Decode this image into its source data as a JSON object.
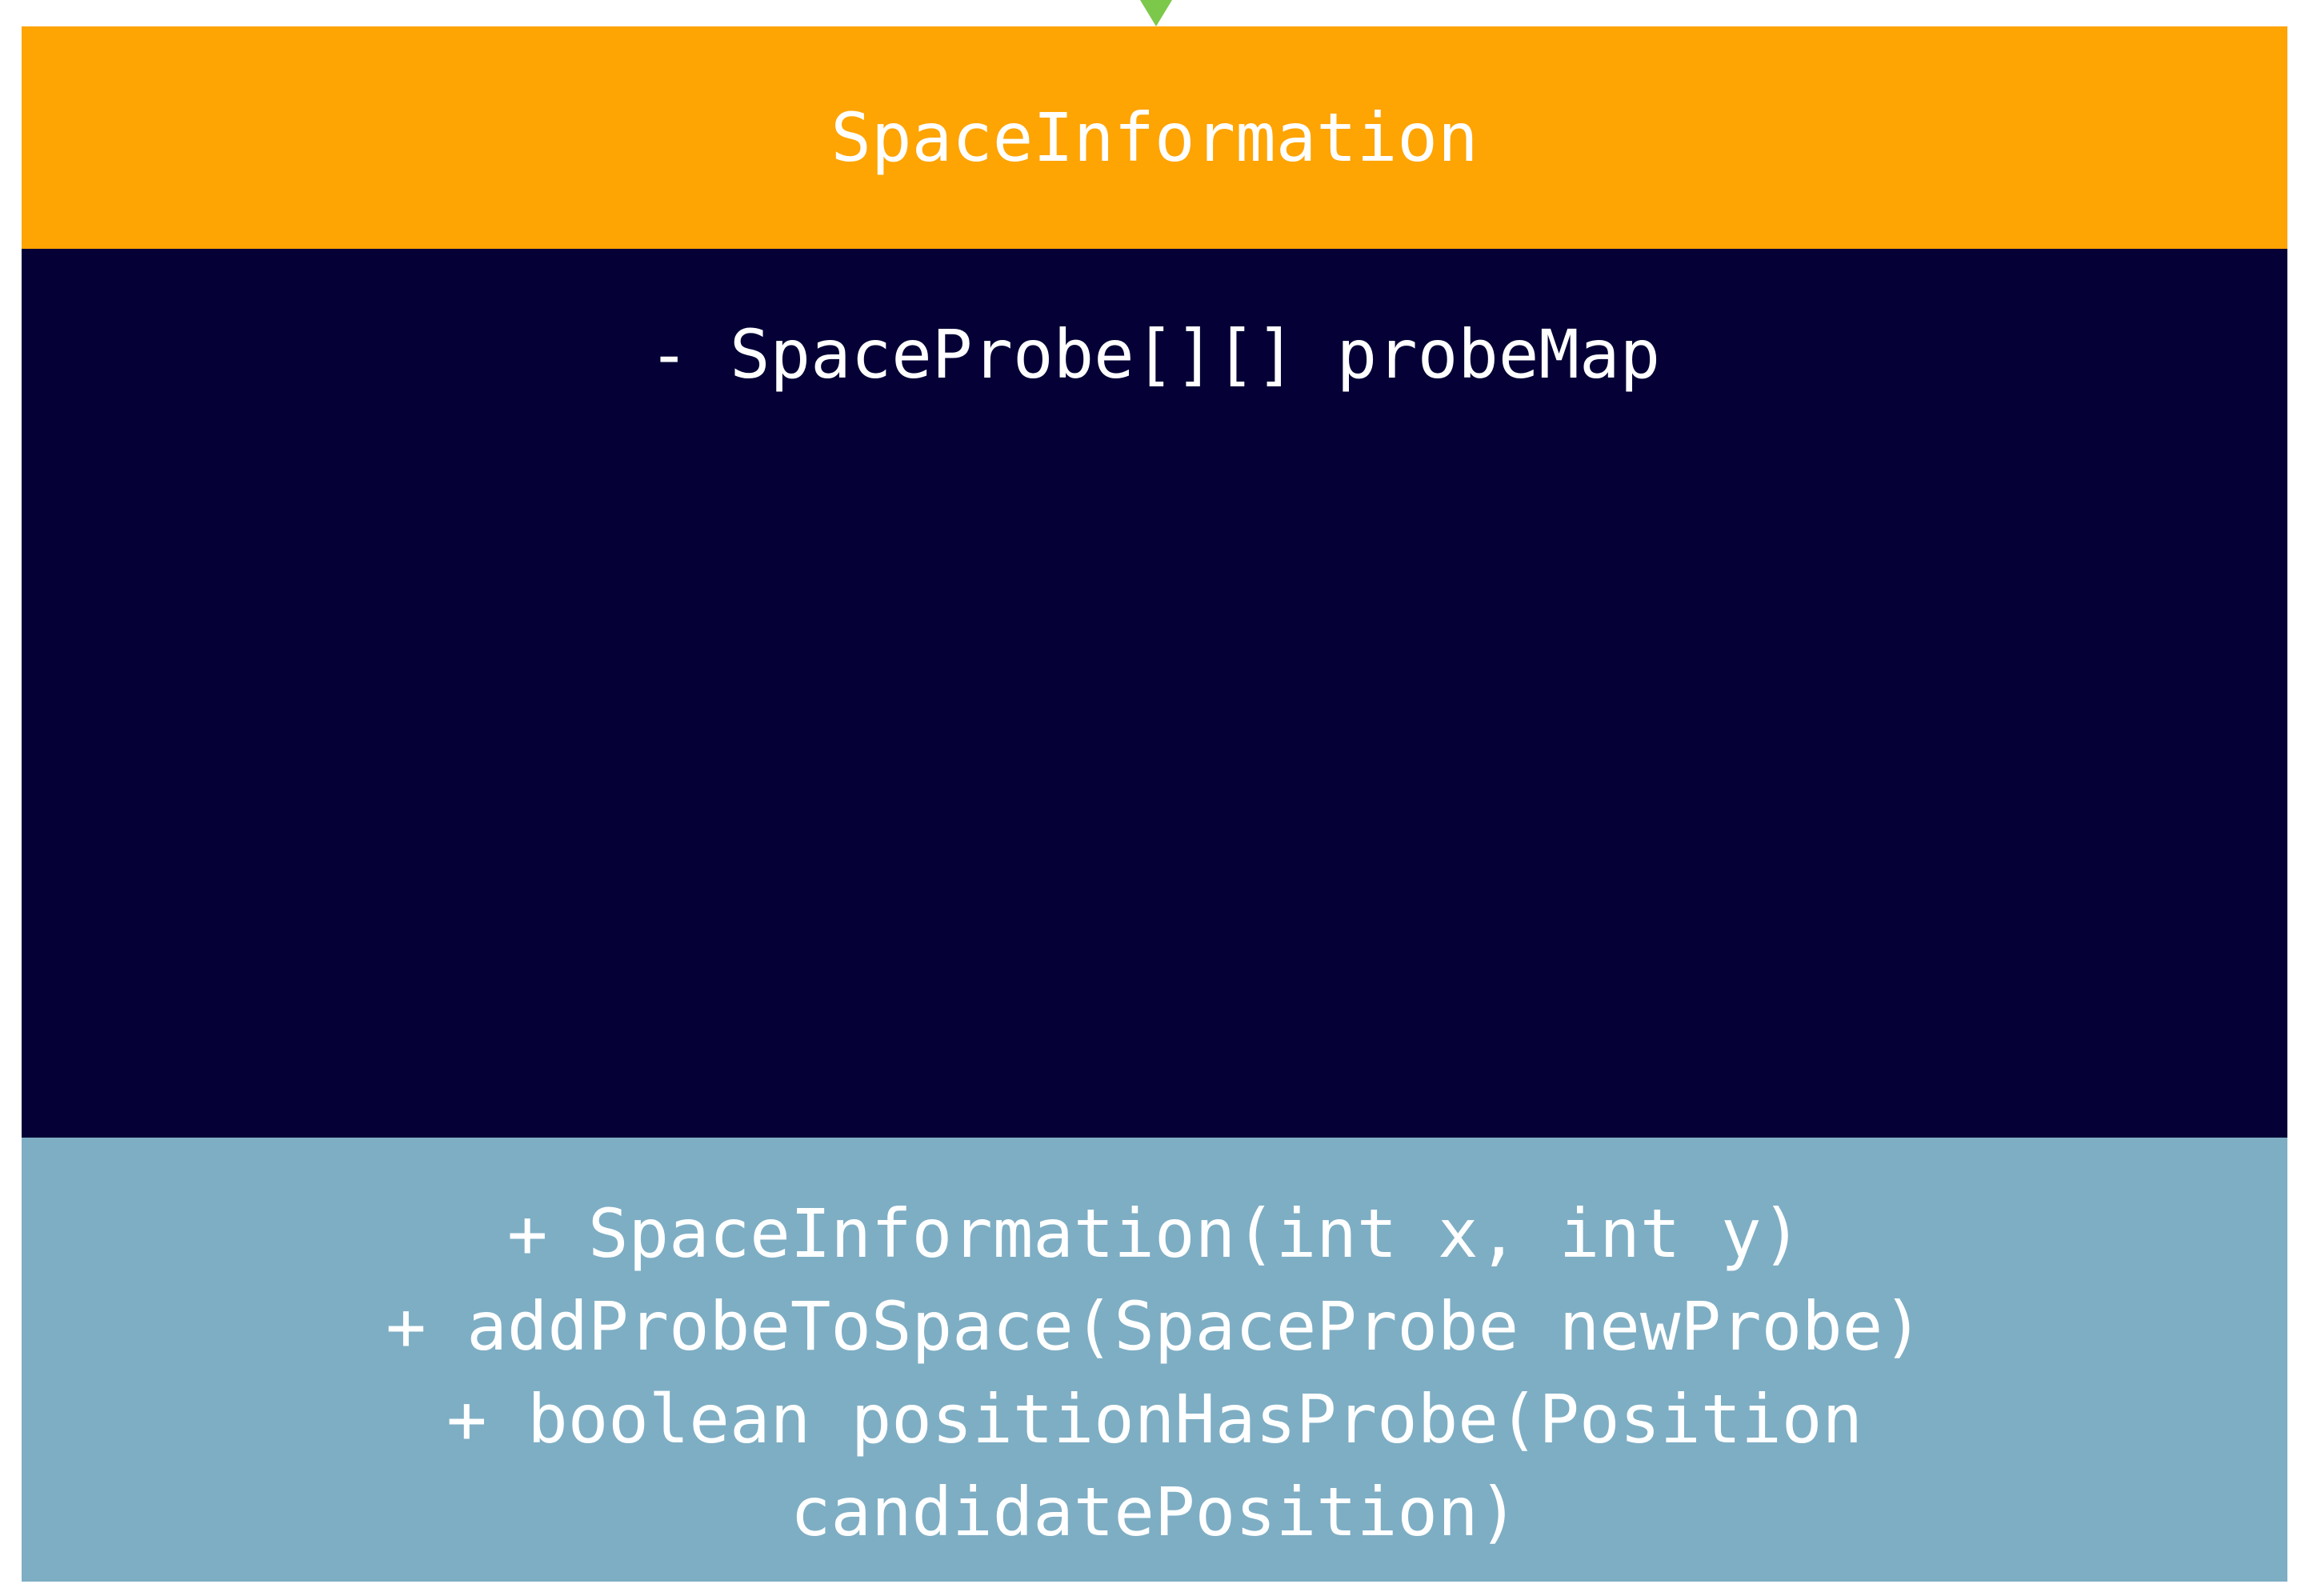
{
  "colors": {
    "header_bg": "#fea403",
    "attributes_bg": "#050136",
    "methods_bg": "#7eaec4",
    "arrow": "#7cc84b",
    "text": "#ffffff"
  },
  "uml_class": {
    "name": "SpaceInformation",
    "attributes": [
      "- SpaceProbe[][] probeMap"
    ],
    "methods": [
      "+ SpaceInformation(int x, int y)",
      "+ addProbeToSpace(SpaceProbe newProbe)",
      "+ boolean positionHasProbe(Position",
      "candidatePosition)"
    ]
  }
}
